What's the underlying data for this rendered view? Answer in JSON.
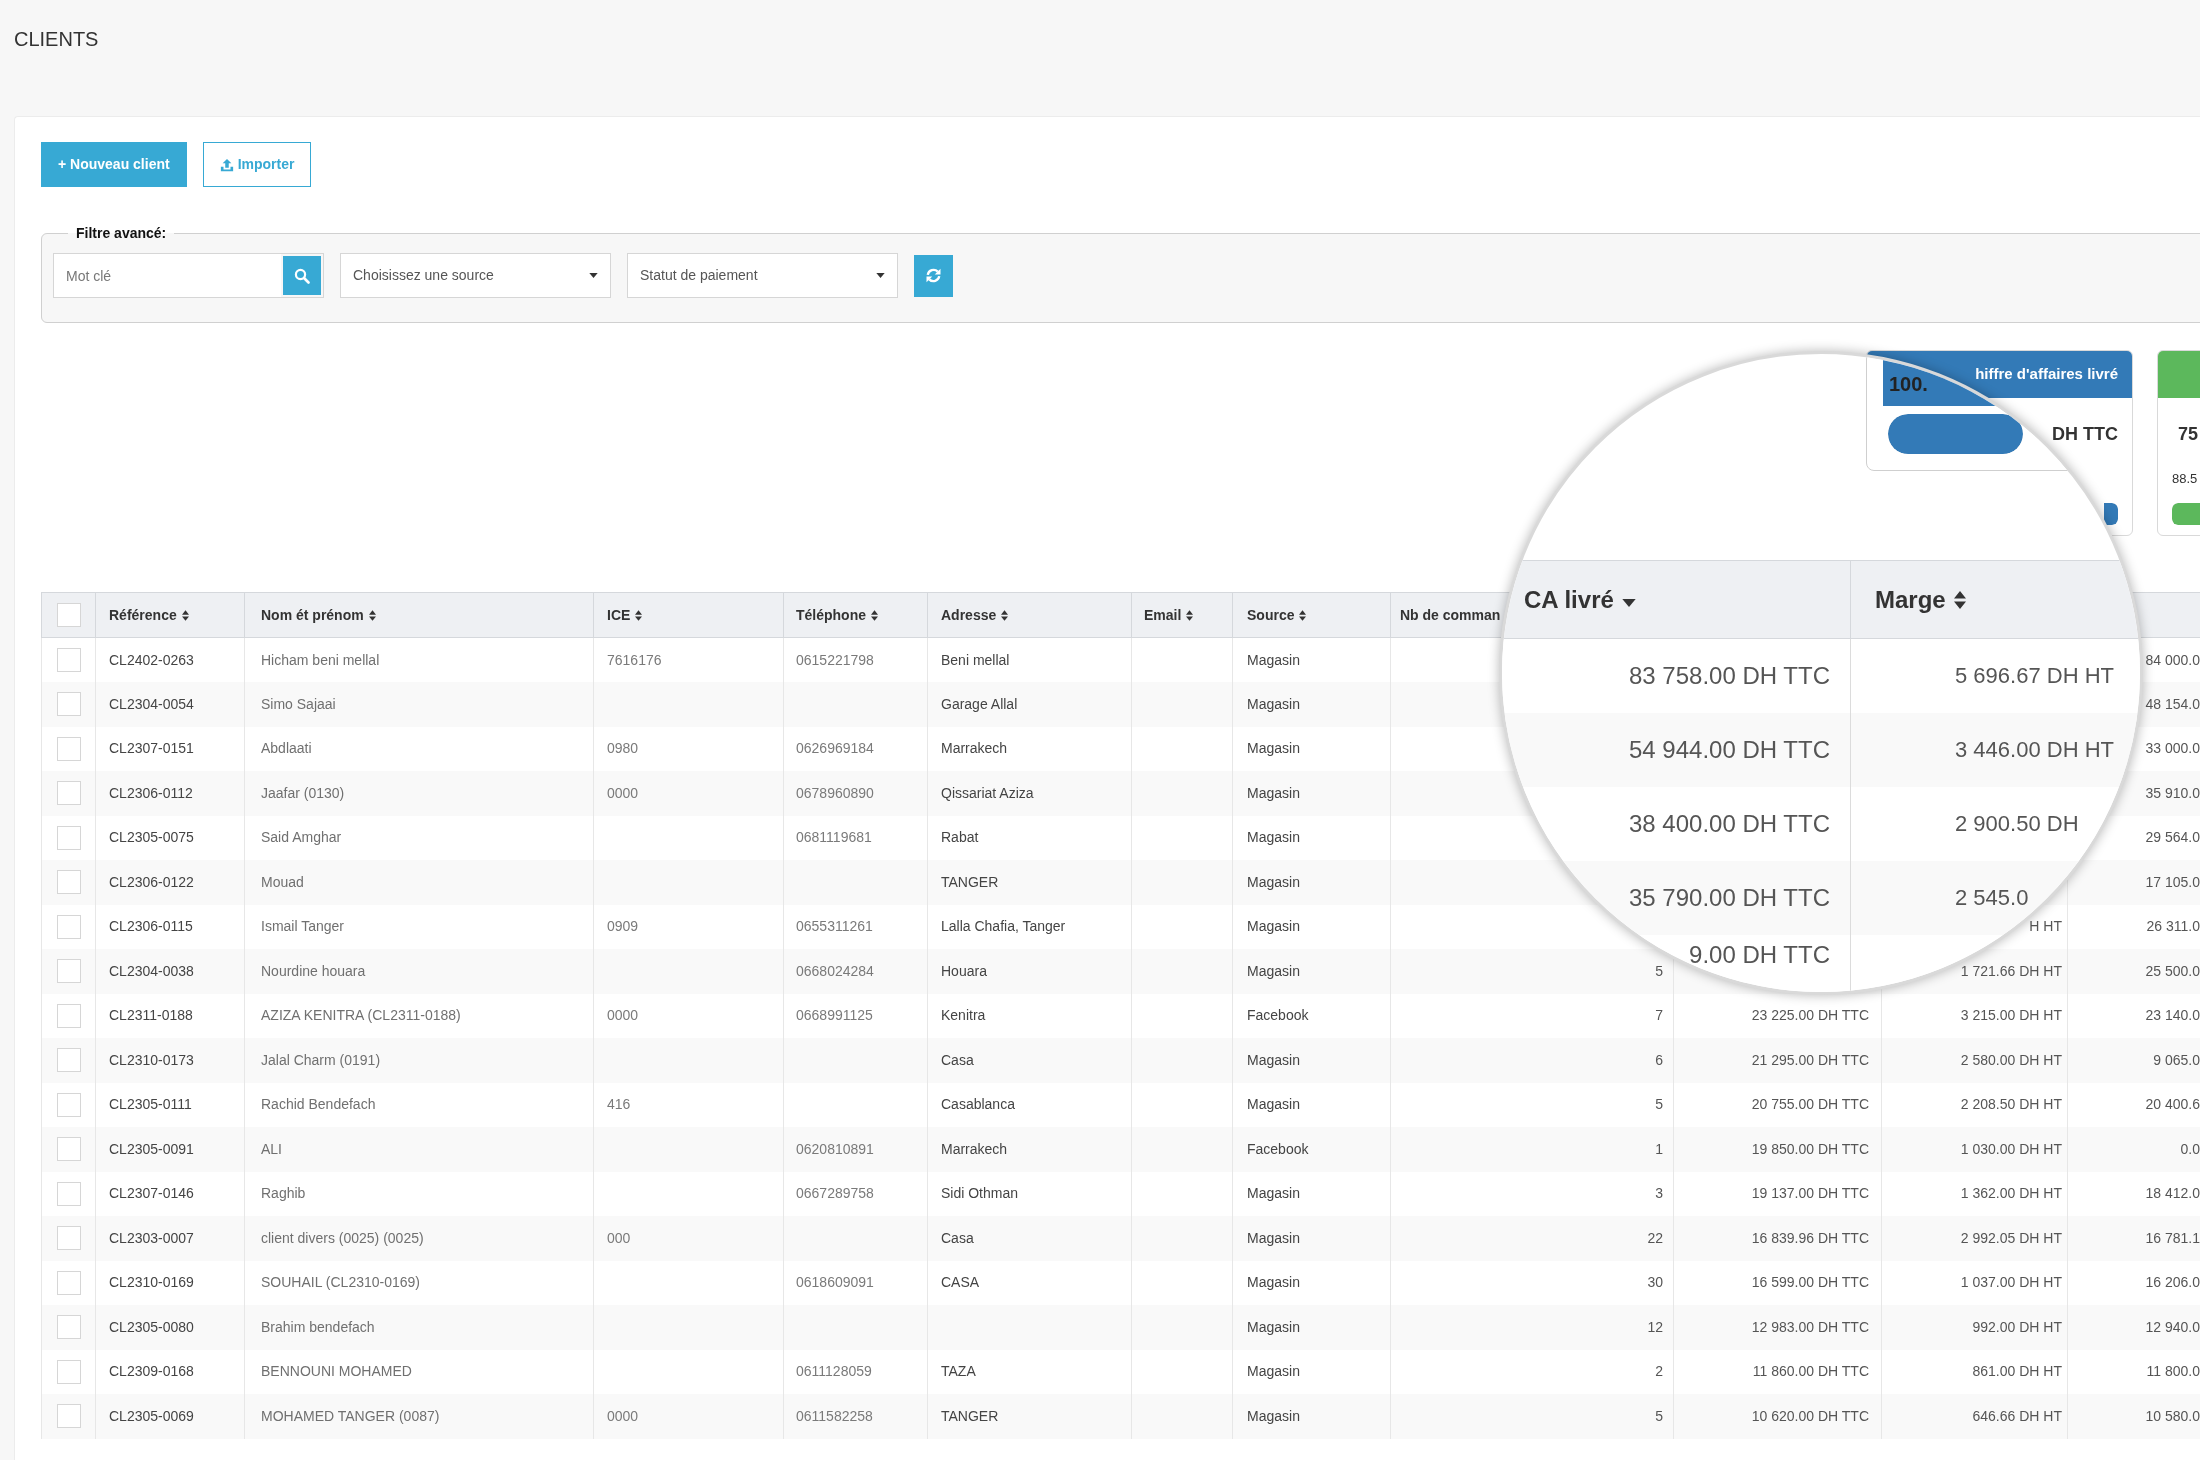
{
  "page": {
    "title": "CLIENTS"
  },
  "toolbar": {
    "buttons": [
      {
        "kind": "create",
        "label": "+ Nouveau client"
      },
      {
        "kind": "import",
        "label": "Importer"
      }
    ]
  },
  "filter": {
    "legend": "Filtre avancé:",
    "keyword": {
      "placeholder": "Mot clé"
    },
    "selects": [
      {
        "placeholder": "Choisissez une source"
      },
      {
        "placeholder": "Statut de paiement"
      }
    ]
  },
  "cards": [
    {
      "title": "hiffre d'affaires livré",
      "value": "DH TTC",
      "level": 1,
      "color": "#337ab7"
    },
    {
      "value": "75",
      "percent": "88.5",
      "level": 0.885,
      "color": "#5cb85c"
    }
  ],
  "table": {
    "select_all": {
      "checked": false
    },
    "columns": [
      {
        "label": "Référence",
        "sorted": false
      },
      {
        "label": "Nom ét prénom",
        "sorted": false
      },
      {
        "label": "ICE",
        "sorted": false
      },
      {
        "label": "Téléphone",
        "sorted": false
      },
      {
        "label": "Adresse",
        "sorted": false
      },
      {
        "label": "Email",
        "sorted": false
      },
      {
        "label": "Source",
        "sorted": false
      },
      {
        "label": "Nb de comman"
      }
    ],
    "rows": [
      {
        "checked": false,
        "reference": "CL2402-0263",
        "name": "Hicham beni mellal",
        "ice": "7616176",
        "phone": "0615221798",
        "address": "Beni mellal",
        "source": "Magasin",
        "column_12": "84 000.0"
      },
      {
        "checked": false,
        "reference": "CL2304-0054",
        "name": "Simo Sajaai",
        "address": "Garage Allal",
        "source": "Magasin",
        "column_12": "48 154.0"
      },
      {
        "checked": false,
        "reference": "CL2307-0151",
        "name": "Abdlaati",
        "ice": "0980",
        "phone": "0626969184",
        "address": "Marrakech",
        "source": "Magasin",
        "column_12": "33 000.0"
      },
      {
        "checked": false,
        "reference": "CL2306-0112",
        "name": "Jaafar (0130)",
        "ice": "0000",
        "phone": "0678960890",
        "address": "Qissariat Aziza",
        "source": "Magasin",
        "column_12": "35 910.0"
      },
      {
        "checked": false,
        "reference": "CL2305-0075",
        "name": "Said Amghar",
        "phone": "0681119681",
        "address": "Rabat",
        "source": "Magasin",
        "column_12": "29 564.0"
      },
      {
        "checked": false,
        "reference": "CL2306-0122",
        "name": "Mouad",
        "address": "TANGER",
        "source": "Magasin",
        "column_12": "17 105.0"
      },
      {
        "checked": false,
        "reference": "CL2306-0115",
        "name": "Ismail Tanger",
        "ice": "0909",
        "phone": "0655311261",
        "address": "Lalla Chafia, Tanger",
        "source": "Magasin",
        "marge": "H HT",
        "column_12": "26 311.0"
      },
      {
        "checked": false,
        "reference": "CL2304-0038",
        "name": "Nourdine houara",
        "phone": "0668024284",
        "address": "Houara",
        "source": "Magasin",
        "orders": "5",
        "marge": "1 721.66 DH HT",
        "column_12": "25 500.0"
      },
      {
        "checked": false,
        "reference": "CL2311-0188",
        "name": "AZIZA KENITRA (CL2311-0188)",
        "ice": "0000",
        "phone": "0668991125",
        "address": "Kenitra",
        "source": "Facebook",
        "orders": "7",
        "ca_livre": "23 225.00 DH TTC",
        "marge": "3 215.00 DH HT",
        "column_12": "23 140.0"
      },
      {
        "checked": false,
        "reference": "CL2310-0173",
        "name": "Jalal Charm (0191)",
        "address": "Casa",
        "source": "Magasin",
        "orders": "6",
        "ca_livre": "21 295.00 DH TTC",
        "marge": "2 580.00 DH HT",
        "column_12": "9 065.0"
      },
      {
        "checked": false,
        "reference": "CL2305-0111",
        "name": "Rachid Bendefach",
        "ice": "416",
        "address": "Casablanca",
        "source": "Magasin",
        "orders": "5",
        "ca_livre": "20 755.00 DH TTC",
        "marge": "2 208.50 DH HT",
        "column_12": "20 400.6"
      },
      {
        "checked": false,
        "reference": "CL2305-0091",
        "name": "ALI",
        "phone": "0620810891",
        "address": "Marrakech",
        "source": "Facebook",
        "orders": "1",
        "ca_livre": "19 850.00 DH TTC",
        "marge": "1 030.00 DH HT",
        "column_12": "0.0"
      },
      {
        "checked": false,
        "reference": "CL2307-0146",
        "name": "Raghib",
        "phone": "0667289758",
        "address": "Sidi Othman",
        "source": "Magasin",
        "orders": "3",
        "ca_livre": "19 137.00 DH TTC",
        "marge": "1 362.00 DH HT",
        "column_12": "18 412.0"
      },
      {
        "checked": false,
        "reference": "CL2303-0007",
        "name": "client divers (0025) (0025)",
        "ice": "000",
        "address": "Casa",
        "source": "Magasin",
        "orders": "22",
        "ca_livre": "16 839.96 DH TTC",
        "marge": "2 992.05 DH HT",
        "column_12": "16 781.1"
      },
      {
        "checked": false,
        "reference": "CL2310-0169",
        "name": "SOUHAIL (CL2310-0169)",
        "phone": "0618609091",
        "address": "CASA",
        "source": "Magasin",
        "orders": "30",
        "ca_livre": "16 599.00 DH TTC",
        "marge": "1 037.00 DH HT",
        "column_12": "16 206.0"
      },
      {
        "checked": false,
        "reference": "CL2305-0080",
        "name": "Brahim bendefach",
        "source": "Magasin",
        "orders": "12",
        "ca_livre": "12 983.00 DH TTC",
        "marge": "992.00 DH HT",
        "column_12": "12 940.0"
      },
      {
        "checked": false,
        "reference": "CL2309-0168",
        "name": "BENNOUNI MOHAMED",
        "phone": "0611128059",
        "address": "TAZA",
        "source": "Magasin",
        "orders": "2",
        "ca_livre": "11 860.00 DH TTC",
        "marge": "861.00 DH HT",
        "column_12": "11 800.0"
      },
      {
        "checked": false,
        "reference": "CL2305-0069",
        "name": "MOHAMED TANGER (0087)",
        "ice": "0000",
        "phone": "0611582258",
        "address": "TANGER",
        "source": "Magasin",
        "orders": "5",
        "ca_livre": "10 620.00 DH TTC",
        "marge": "646.66 DH HT",
        "column_12": "10 580.0"
      }
    ]
  },
  "magnifier": {
    "card": {
      "label": "100.",
      "level": 1
    },
    "columns": [
      {
        "label": "CA livré",
        "sorted": true
      },
      {
        "label": "Marge",
        "sorted": false
      }
    ],
    "rows": [
      {
        "ca_livre": "83 758.00 DH TTC",
        "marge": "5 696.67 DH HT"
      },
      {
        "ca_livre": "54 944.00 DH TTC",
        "marge": "3 446.00 DH HT"
      },
      {
        "ca_livre": "38 400.00 DH TTC",
        "marge": "2 900.50 DH"
      },
      {
        "ca_livre": "35 790.00 DH TTC",
        "marge": "2 545.0"
      },
      {
        "ca_livre": "9.00 DH TTC"
      }
    ]
  }
}
